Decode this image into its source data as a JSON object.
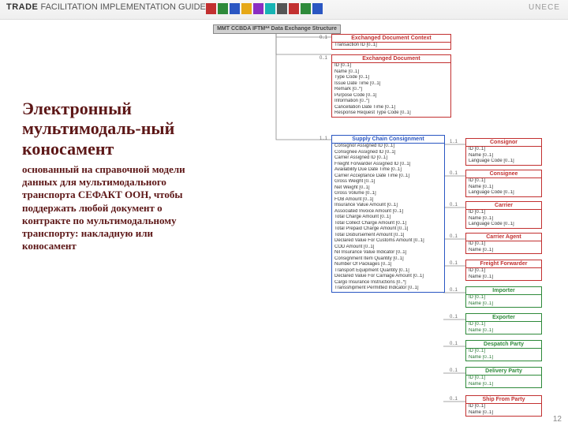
{
  "header": {
    "logo_main": "TRADE",
    "logo_sub": "FACILITATION IMPLEMENTATION GUIDE",
    "right": "UNECE"
  },
  "sidebar": {
    "title": "Электронный мультимодаль-ный коносамент",
    "body": "основанный на справочной модели данных для мультимодального транспорта СЕФАКТ ООН, чтобы поддержать любой документ о контракте по мультимодальному транспорту: накладную или коносамент"
  },
  "diagram": {
    "root": "MMT CCBDA IFTM** Data Exchange Structure",
    "edc": {
      "title": "Exchanged Document Context",
      "lines": [
        "Transaction ID [0..1]"
      ]
    },
    "ed": {
      "title": "Exchanged Document",
      "lines": [
        "ID [0..1]",
        "Name [0..1]",
        "Type Code [0..1]",
        "Issue Date Time [0..1]",
        "Remark [0..*]",
        "Purpose Code [0..1]",
        "Information [0..*]",
        "Cancellation Date Time [0..1]",
        "Response Request Type Code [0..1]"
      ]
    },
    "scc": {
      "title": "Supply Chain Consignment",
      "lines": [
        "Consignor Assigned ID [0..1]",
        "Consignee Assigned ID [0..1]",
        "Carrier Assigned ID [0..1]",
        "Freight Forwarder Assigned ID [0..1]",
        "Availability Due Date Time [0..1]",
        "Carrier Acceptance Date Time [0..1]",
        "Gross Weight [0..1]",
        "Net Weight [0..1]",
        "Gross Volume [0..1]",
        "FOB Amount [0..1]",
        "Insurance Value Amount [0..1]",
        "Associated Invoice Amount [0..1]",
        "Total Charge Amount [0..1]",
        "Total Collect Charge Amount [0..1]",
        "Total Prepaid Charge Amount [0..1]",
        "Total Disbursement Amount [0..1]",
        "Declared Value For Customs Amount [0..1]",
        "COD Amount [0..1]",
        "Nil Insurance Value Indicator [0..1]",
        "Consignment Item Quantity [0..1]",
        "Number Of Packages [0..1]",
        "Transport Equipment Quantity [0..1]",
        "Declared Value For Carriage Amount [0..1]",
        "Cargo Insurance Instructions [0..*]",
        "Transshipment Permitted Indicator [0..1]"
      ]
    },
    "parties": {
      "consignor": {
        "title": "Consignor",
        "lines": [
          "ID [0..1]",
          "Name [0..1]",
          "Language Code [0..1]"
        ]
      },
      "consignee": {
        "title": "Consignee",
        "lines": [
          "ID [0..1]",
          "Name [0..1]",
          "Language Code [0..1]"
        ]
      },
      "carrier": {
        "title": "Carrier",
        "lines": [
          "ID [0..1]",
          "Name [0..1]",
          "Language Code [0..1]"
        ]
      },
      "agent": {
        "title": "Carrier Agent",
        "lines": [
          "ID [0..1]",
          "Name [0..1]"
        ]
      },
      "forwarder": {
        "title": "Freight Forwarder",
        "lines": [
          "ID [0..1]",
          "Name [0..1]"
        ]
      },
      "importer": {
        "title": "Importer",
        "lines": [
          "ID [0..1]",
          "Name [0..1]"
        ]
      },
      "exporter": {
        "title": "Exporter",
        "lines": [
          "ID [0..1]",
          "Name [0..1]"
        ]
      },
      "despatch": {
        "title": "Despatch Party",
        "lines": [
          "ID [0..1]",
          "Name [0..1]"
        ]
      },
      "delivery": {
        "title": "Delivery Party",
        "lines": [
          "ID [0..1]",
          "Name [0..1]"
        ]
      },
      "shipfrom": {
        "title": "Ship From Party",
        "lines": [
          "ID [0..1]",
          "Name [0..1]"
        ]
      }
    },
    "card": {
      "one": "1..1",
      "zero": "0..1"
    }
  },
  "stripe_colors": [
    "#c23030",
    "#2e8a3a",
    "#2a56c2",
    "#e6a817",
    "#8a2ec2",
    "#17b4b4",
    "#555",
    "#c23030",
    "#2e8a3a",
    "#2a56c2"
  ],
  "page_number": "12"
}
